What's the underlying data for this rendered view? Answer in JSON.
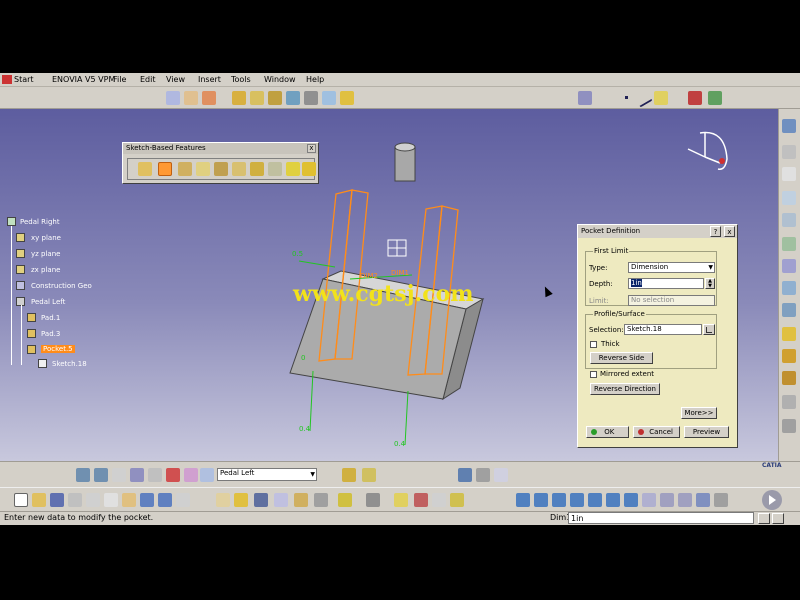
{
  "menubar": {
    "start": "Start",
    "items": [
      "ENOVIA V5 VPM",
      "File",
      "Edit",
      "View",
      "Insert",
      "Tools",
      "Window",
      "Help"
    ]
  },
  "tree": {
    "root": "Pedal Right",
    "items": [
      "xy plane",
      "yz plane",
      "zx plane",
      "Construction Geo",
      "Pedal Left",
      "Pad.1",
      "Pad.3",
      "Pocket.5",
      "Sketch.18"
    ]
  },
  "sbf_panel": {
    "title": "Sketch-Based Features",
    "close": "x"
  },
  "viewport": {
    "dims": [
      "0.5",
      "DIM2",
      "DIM1",
      "0.4",
      "0.4",
      "0"
    ],
    "watermark": "www.cgtsj.com"
  },
  "pocket_dialog": {
    "title": "Pocket Definition",
    "first_limit": "First Limit",
    "type_label": "Type:",
    "type_value": "Dimension",
    "depth_label": "Depth:",
    "depth_value": "1in",
    "limit_label": "Limit:",
    "limit_value": "No selection",
    "profile_group": "Profile/Surface",
    "selection_label": "Selection:",
    "selection_value": "Sketch.18",
    "thick_label": "Thick",
    "reverse_side": "Reverse Side",
    "mirrored_extent": "Mirrored extent",
    "reverse_direction": "Reverse Direction",
    "more": "More>>",
    "ok": "OK",
    "cancel": "Cancel",
    "preview": "Preview",
    "help": "?",
    "close": "x"
  },
  "bottom_toolbar": {
    "selector_value": "Pedal Left"
  },
  "statusbar": {
    "message": "Enter new data to modify the pocket.",
    "dim_label": "Dim1",
    "dim_value": "1in"
  },
  "logo": "CATIA",
  "colors": {
    "sketch_orange": "#ff8c1a",
    "dim_green": "#22c522",
    "watermark_yellow": "#f2e21a"
  }
}
